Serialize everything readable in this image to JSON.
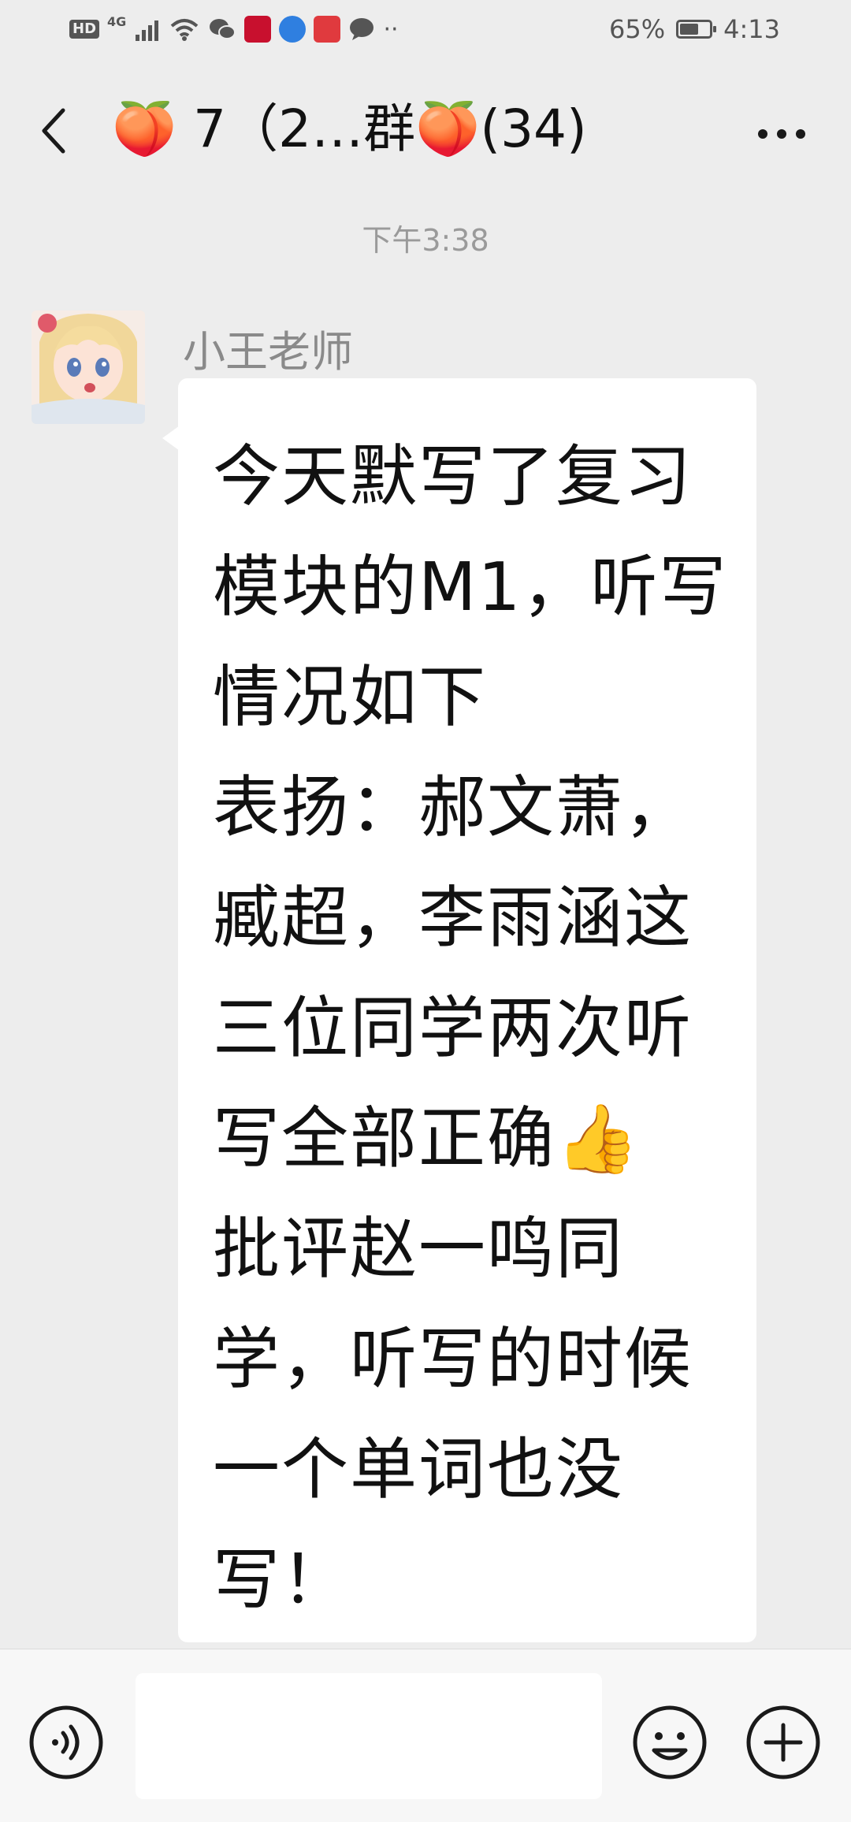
{
  "status_bar": {
    "hd_label": "HD",
    "network_label": "4G",
    "battery_text": "65%",
    "battery_level": 0.65,
    "time": "4:13",
    "overflow_label": "··"
  },
  "header": {
    "title": "🍑 7（2…群🍑(34)"
  },
  "conversation": {
    "timestamp": "下午3:38",
    "messages": [
      {
        "sender": "小王老师",
        "text": "今天默写了复习模块的M1，听写情况如下\n表扬：郝文萧，臧超，李雨涵这三位同学两次听写全部正确👍\n批评赵一鸣同学，听写的时候一个单词也没写！"
      }
    ]
  },
  "input_bar": {
    "value": ""
  },
  "colors": {
    "background": "#ededed",
    "bubble": "#ffffff",
    "wechat_green": "#07c160"
  },
  "icons": {
    "back": "chevron-left-icon",
    "more": "more-dots-icon",
    "voice": "voice-icon",
    "emoji": "emoji-icon",
    "plus": "plus-icon"
  }
}
